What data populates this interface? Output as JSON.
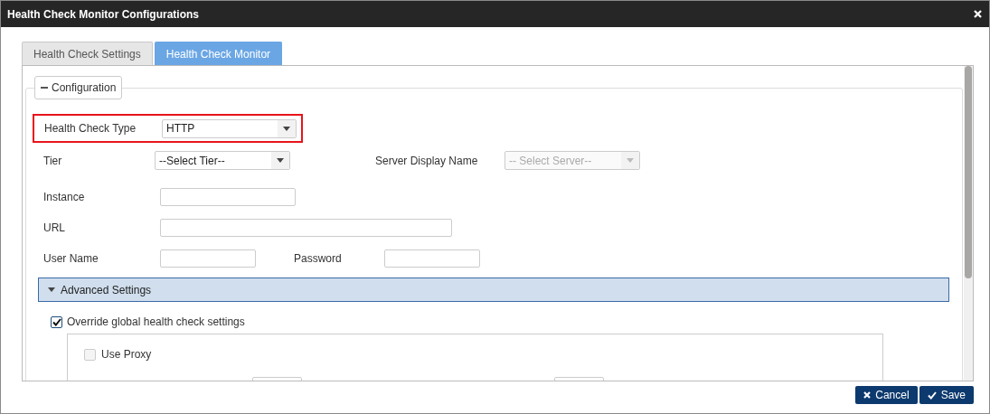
{
  "window": {
    "title": "Health Check Monitor Configurations"
  },
  "tabs": [
    {
      "label": "Health Check Settings",
      "selected": false
    },
    {
      "label": "Health Check Monitor",
      "selected": true
    }
  ],
  "configuration": {
    "legend": "Configuration",
    "expanded": true,
    "health_check_type": {
      "label": "Health Check Type",
      "value": "HTTP",
      "highlighted": true
    },
    "tier": {
      "label": "Tier",
      "value": "--Select Tier--"
    },
    "server_display_name": {
      "label": "Server Display Name",
      "value": "-- Select Server--",
      "disabled": true
    },
    "instance": {
      "label": "Instance"
    },
    "url": {
      "label": "URL"
    },
    "user_name": {
      "label": "User Name"
    },
    "password": {
      "label": "Password"
    },
    "advanced_settings": {
      "label": "Advanced Settings",
      "expanded": true,
      "override": {
        "label": "Override global health check settings",
        "checked": true
      },
      "use_proxy": {
        "label": "Use Proxy",
        "checked": false
      }
    }
  },
  "buttons": [
    {
      "label": "Cancel",
      "kind": "cancel"
    },
    {
      "label": "Save",
      "kind": "save"
    }
  ]
}
